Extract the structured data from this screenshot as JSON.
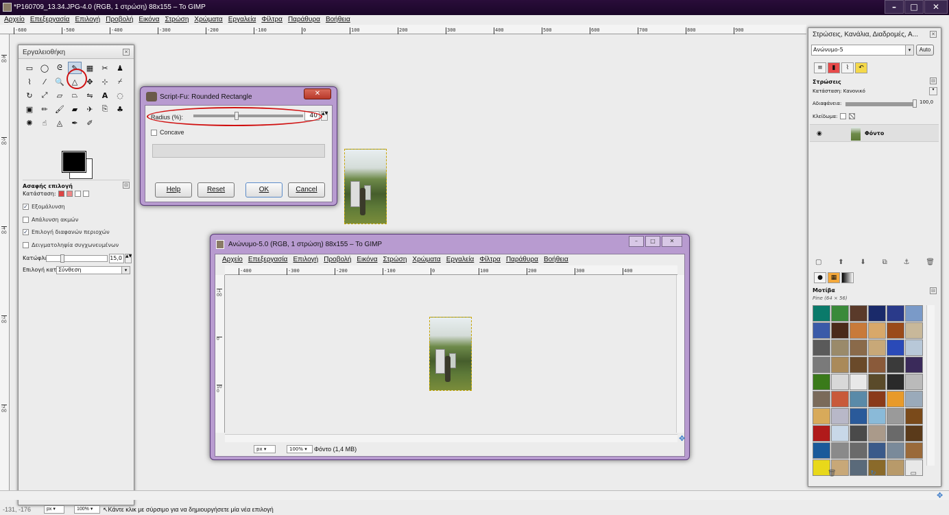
{
  "window": {
    "title": "*P160709_13.34.JPG-4.0 (RGB, 1 στρώση) 88x155 – To GIMP",
    "minimize_label": "–",
    "maximize_label": "□",
    "close_label": "✕"
  },
  "menubar": {
    "items": [
      "Αρχείο",
      "Επεξεργασία",
      "Επιλογή",
      "Προβολή",
      "Εικόνα",
      "Στρώση",
      "Χρώματα",
      "Εργαλεία",
      "Φίλτρα",
      "Παράθυρα",
      "Βοήθεια"
    ]
  },
  "ruler": {
    "ticks": [
      "-600",
      "-500",
      "-400",
      "-300",
      "-200",
      "-100",
      "0",
      "100",
      "200",
      "300",
      "400",
      "500",
      "600",
      "700",
      "800",
      "900"
    ]
  },
  "toolbox": {
    "title": "Εργαλειοθήκη",
    "options_title": "Ασαφής επιλογή",
    "mode_label": "Κατάσταση:",
    "antialias_label": "Εξομάλυνση",
    "feather_label": "Απάλυνση ακμών",
    "transparent_label": "Επιλογή διαφανών περιοχών",
    "sample_merged_label": "Δειγματοληψία συγχωνευμένων",
    "threshold_label": "Κατώφλι:",
    "threshold_value": "15,0",
    "select_by_label": "Επιλογή κατά:",
    "select_by_value": "Σύνθεση"
  },
  "scriptfu": {
    "title": "Script-Fu: Rounded Rectangle",
    "radius_label": "Radius (%):",
    "radius_value": "40",
    "radius_fraction": 0.4,
    "concave_label": "Concave",
    "help_label": "Help",
    "reset_label": "Reset",
    "ok_label": "OK",
    "cancel_label": "Cancel"
  },
  "image_window": {
    "title": "Ανώνυμο-5.0 (RGB, 1 στρώση) 88x155 – To GIMP",
    "menu": [
      "Αρχείο",
      "Επεξεργασία",
      "Επιλογή",
      "Προβολή",
      "Εικόνα",
      "Στρώση",
      "Χρώματα",
      "Εργαλεία",
      "Φίλτρα",
      "Παράθυρα",
      "Βοήθεια"
    ],
    "ruler_ticks": [
      "-400",
      "-300",
      "-200",
      "-100",
      "0",
      "100",
      "200",
      "300",
      "400"
    ],
    "unit": "px",
    "zoom": "100%",
    "status": "Φόντο (1,4 MB)"
  },
  "right_dock": {
    "title": "Στρώσεις, Κανάλια, Διαδρομές, Α...",
    "image_select": "Ανώνυμο-5",
    "auto_label": "Auto",
    "layers_title": "Στρώσεις",
    "mode_label": "Κατάσταση:",
    "mode_value": "Κανονικό",
    "opacity_label": "Αδιαφάνεια:",
    "opacity_value": "100,0",
    "lock_label": "Κλείδωμα:",
    "layer_name": "Φόντο",
    "patterns_title": "Μοτίβα",
    "pattern_name": "Pine (64 × 56)",
    "pattern_colors": [
      "#0a7a6a",
      "#3a8a3a",
      "#5a3a2a",
      "#1a2a6a",
      "#2a3a8a",
      "#7a9ac8",
      "#3a5aa8",
      "#4a2a1a",
      "#c87a3a",
      "#d8a86a",
      "#9a4a1a",
      "#c8b89a",
      "#5a5a5a",
      "#9a8a6a",
      "#8a6a4a",
      "#c8a878",
      "#2a4ab8",
      "#b8c8d8",
      "#7a7a7a",
      "#aa8a5a",
      "#6a4a2a",
      "#8a5a3a",
      "#3a3a3a",
      "#3a2a5a",
      "#3a7a1a",
      "#d8d8d8",
      "#e8e8e8",
      "#5a4a2a",
      "#2a2a2a",
      "#bababa",
      "#7a6a5a",
      "#c85a3a",
      "#5a8aa8",
      "#8a3a1a",
      "#e89a2a",
      "#9aaaba",
      "#d8aa5a",
      "#b8b8c8",
      "#2a5a9a",
      "#8abad8",
      "#9a9a9a",
      "#7a4a1a",
      "#b01a1a",
      "#c8d8e8",
      "#4a4a4a",
      "#aa9a8a",
      "#6a6a6a",
      "#5a3a1a",
      "#1a5a9a",
      "#8a8a8a",
      "#6a6a6a",
      "#3a5a8a",
      "#7a8a9a",
      "#9a6a3a",
      "#e8d81a",
      "#c8a878",
      "#5a6a7a",
      "#8a6a2a",
      "#b89a6a",
      "#e8e8e8"
    ]
  },
  "statusbar": {
    "coords": "-131, -176",
    "unit": "px",
    "zoom": "100%",
    "message": "Κάντε κλικ με σύρσιμο για να δημιουργήσετε μία νέα επιλογή"
  }
}
